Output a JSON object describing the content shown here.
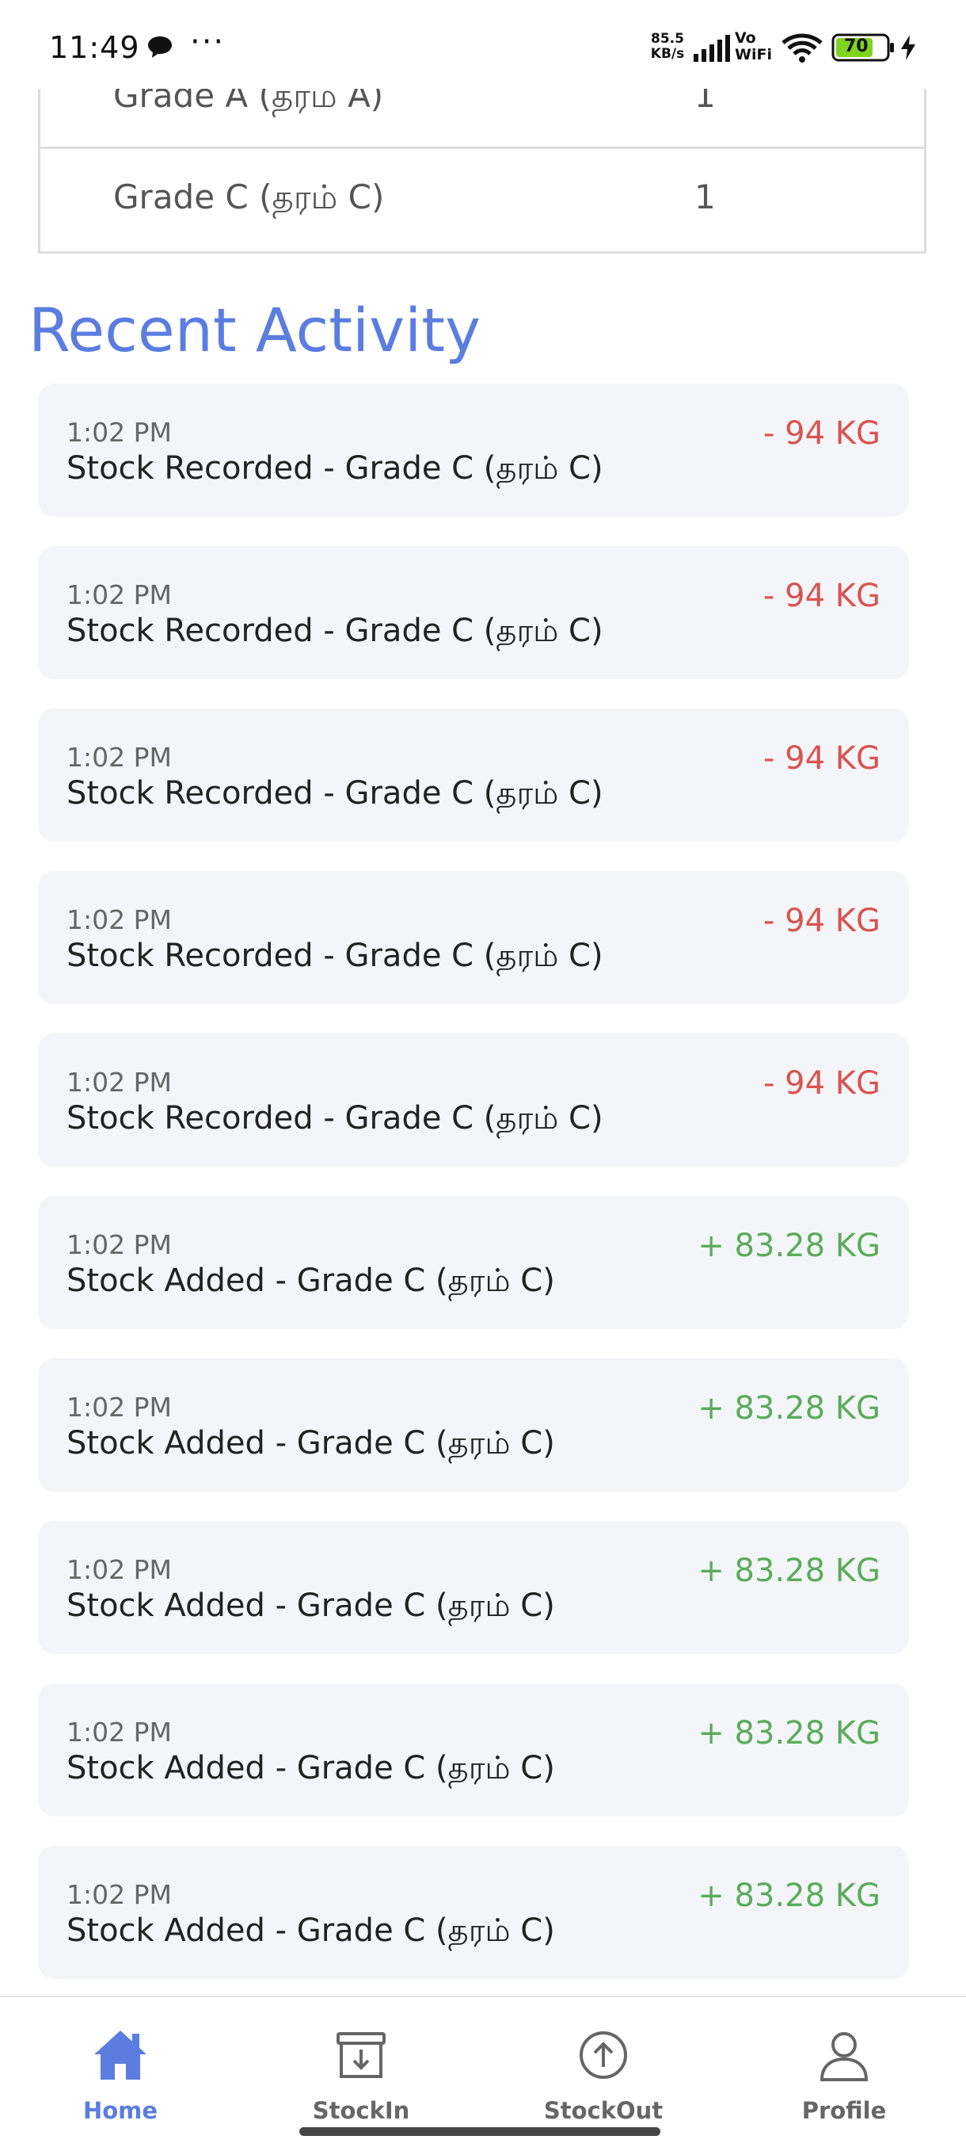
{
  "status_bar": {
    "time": "11:49",
    "more": "···",
    "net_speed_value": "85.5",
    "net_speed_unit": "KB/s",
    "vo": "Vo",
    "wifi_label": "WiFi",
    "battery_level": "70",
    "battery_color": "#7ed321"
  },
  "grades": [
    {
      "name": "Grade A (தரம் A)",
      "count": "1"
    },
    {
      "name": "Grade C (தரம் C)",
      "count": "1"
    }
  ],
  "recent_activity": {
    "title": "Recent Activity",
    "items": [
      {
        "time": "1:02 PM",
        "title": "Stock Recorded - Grade C (தரம் C)",
        "amount": "- 94 KG",
        "direction": "out"
      },
      {
        "time": "1:02 PM",
        "title": "Stock Recorded - Grade C (தரம் C)",
        "amount": "- 94 KG",
        "direction": "out"
      },
      {
        "time": "1:02 PM",
        "title": "Stock Recorded - Grade C (தரம் C)",
        "amount": "- 94 KG",
        "direction": "out"
      },
      {
        "time": "1:02 PM",
        "title": "Stock Recorded - Grade C (தரம் C)",
        "amount": "- 94 KG",
        "direction": "out"
      },
      {
        "time": "1:02 PM",
        "title": "Stock Recorded - Grade C (தரம் C)",
        "amount": "- 94 KG",
        "direction": "out"
      },
      {
        "time": "1:02 PM",
        "title": "Stock Added - Grade C (தரம் C)",
        "amount": "+ 83.28 KG",
        "direction": "in"
      },
      {
        "time": "1:02 PM",
        "title": "Stock Added - Grade C (தரம் C)",
        "amount": "+ 83.28 KG",
        "direction": "in"
      },
      {
        "time": "1:02 PM",
        "title": "Stock Added - Grade C (தரம் C)",
        "amount": "+ 83.28 KG",
        "direction": "in"
      },
      {
        "time": "1:02 PM",
        "title": "Stock Added - Grade C (தரம் C)",
        "amount": "+ 83.28 KG",
        "direction": "in"
      },
      {
        "time": "1:02 PM",
        "title": "Stock Added - Grade C (தரம் C)",
        "amount": "+ 83.28 KG",
        "direction": "in"
      }
    ]
  },
  "bottom_nav": {
    "items": [
      {
        "label": "Home",
        "icon": "home-icon",
        "active": true
      },
      {
        "label": "StockIn",
        "icon": "stock-in-icon",
        "active": false
      },
      {
        "label": "StockOut",
        "icon": "stock-out-icon",
        "active": false
      },
      {
        "label": "Profile",
        "icon": "profile-icon",
        "active": false
      }
    ]
  },
  "colors": {
    "accent": "#5b7de0",
    "stock_out": "#d9534f",
    "stock_in": "#5aac5a",
    "card_bg": "#f4f5f9"
  }
}
